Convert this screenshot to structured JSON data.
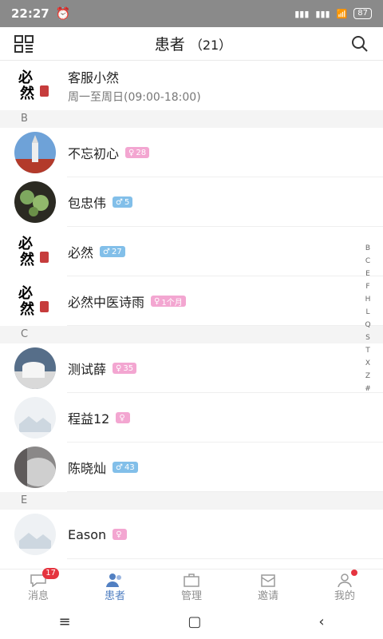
{
  "status": {
    "time": "22:27",
    "battery": "87"
  },
  "header": {
    "title": "患者",
    "count": "（21）"
  },
  "service": {
    "name": "客服小然",
    "hours": "周一至周日(09:00-18:00)"
  },
  "sections": [
    {
      "letter": "B",
      "items": [
        {
          "name": "不忘初心",
          "gender": "female",
          "age": "28",
          "avatar": "church"
        },
        {
          "name": "包忠伟",
          "gender": "male",
          "age": "5",
          "avatar": "plant"
        },
        {
          "name": "必然",
          "gender": "male",
          "age": "27",
          "avatar": "logo"
        },
        {
          "name": "必然中医诗雨",
          "gender": "female",
          "age": "1个月",
          "avatar": "logo"
        }
      ]
    },
    {
      "letter": "C",
      "items": [
        {
          "name": "测试薛",
          "gender": "female",
          "age": "35",
          "avatar": "cup"
        },
        {
          "name": "程益12",
          "gender": "female",
          "age": "",
          "avatar": "placeholder"
        },
        {
          "name": "陈晓灿",
          "gender": "male",
          "age": "43",
          "avatar": "gray"
        }
      ]
    },
    {
      "letter": "E",
      "items": [
        {
          "name": "Eason",
          "gender": "female",
          "age": "",
          "avatar": "placeholder"
        }
      ]
    }
  ],
  "index_letters": [
    "B",
    "C",
    "E",
    "F",
    "H",
    "L",
    "Q",
    "S",
    "T",
    "X",
    "Z",
    "#"
  ],
  "tabs": [
    {
      "label": "消息",
      "badge": "17"
    },
    {
      "label": "患者",
      "active": true
    },
    {
      "label": "管理"
    },
    {
      "label": "邀请"
    },
    {
      "label": "我的",
      "dot": true
    }
  ],
  "colors": {
    "accent": "#5280c2",
    "female": "#f3a6d1",
    "male": "#82bfe9",
    "badge": "#e5343f"
  }
}
